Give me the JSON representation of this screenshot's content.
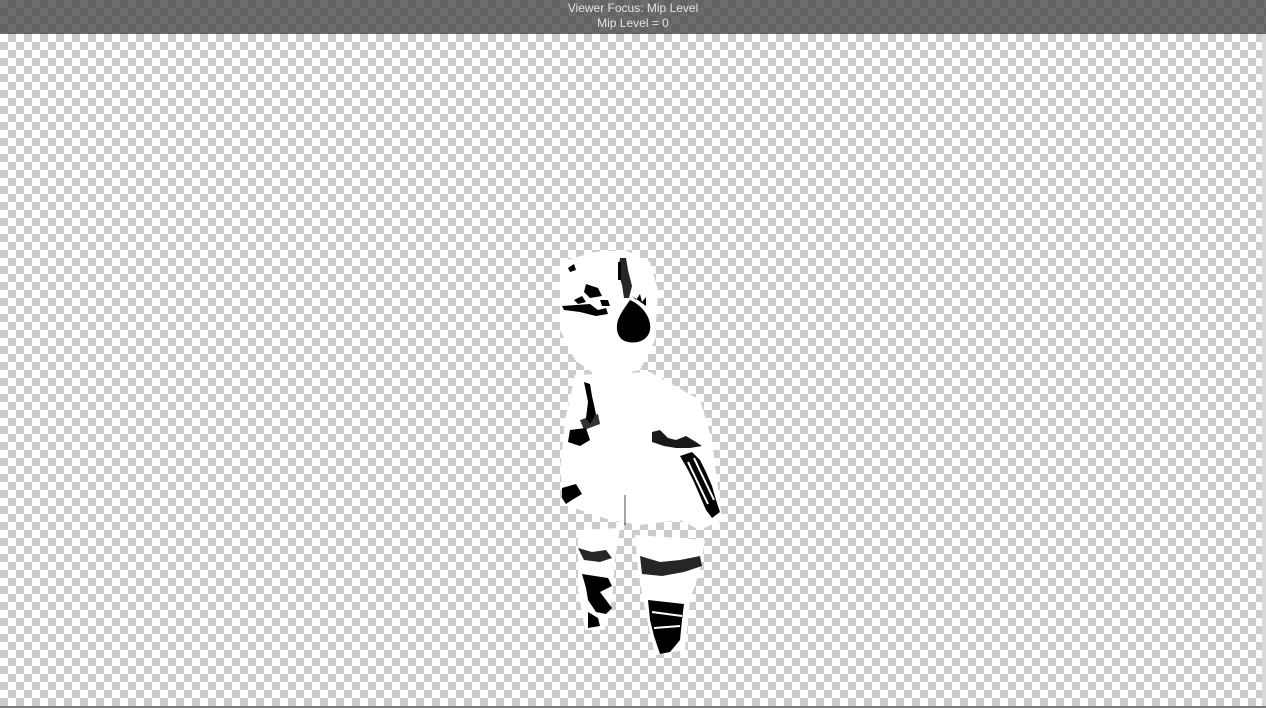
{
  "header": {
    "focus_label": "Viewer Focus: Mip Level",
    "mip_level_label": "Mip Level = 0"
  },
  "canvas": {
    "background": "transparency-checkerboard",
    "checker_light": "#ffffff",
    "checker_dark": "#cccccc"
  },
  "texture": {
    "colors": {
      "fill": "#ffffff",
      "ink": "#000000"
    }
  }
}
